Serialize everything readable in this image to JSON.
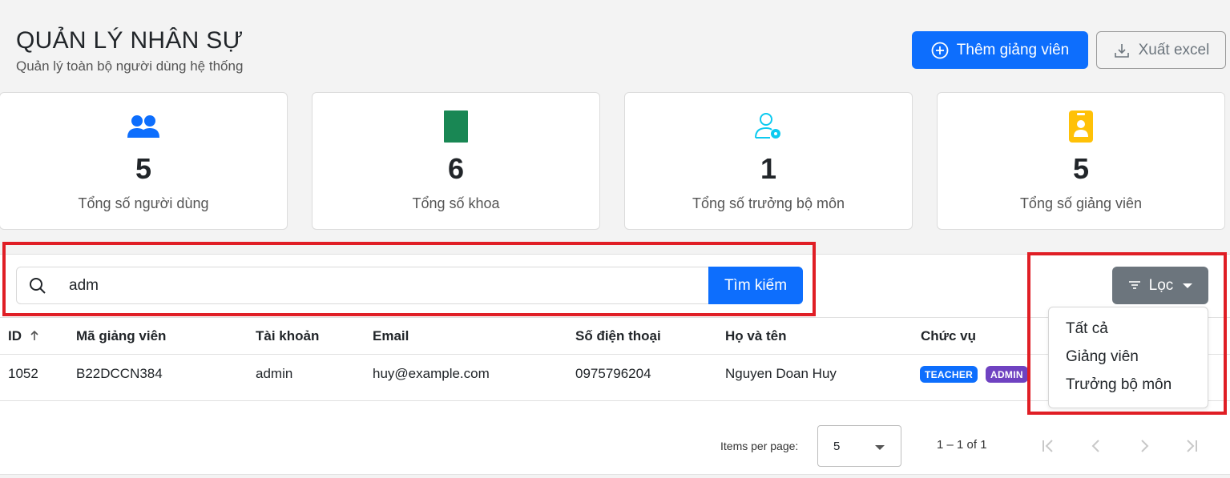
{
  "header": {
    "title": "QUẢN LÝ NHÂN SỰ",
    "subtitle": "Quản lý toàn bộ người dùng hệ thống",
    "add_button": "Thêm giảng viên",
    "export_button": "Xuất excel"
  },
  "stats": [
    {
      "value": "5",
      "label": "Tổng số người dùng",
      "icon": "users-icon",
      "color": "#0d6efd"
    },
    {
      "value": "6",
      "label": "Tổng số khoa",
      "icon": "book-icon",
      "color": "#198754"
    },
    {
      "value": "1",
      "label": "Tổng số trưởng bộ môn",
      "icon": "user-gear-icon",
      "color": "#0dcaf0"
    },
    {
      "value": "5",
      "label": "Tổng số giảng viên",
      "icon": "id-badge-icon",
      "color": "#ffc107"
    }
  ],
  "search": {
    "value": "adm",
    "button": "Tìm kiếm"
  },
  "filter": {
    "button": "Lọc",
    "options": [
      "Tất cả",
      "Giảng viên",
      "Trưởng bộ môn"
    ]
  },
  "table": {
    "columns": [
      "ID",
      "Mã giảng viên",
      "Tài khoản",
      "Email",
      "Số điện thoại",
      "Họ và tên",
      "Chức vụ"
    ],
    "rows": [
      {
        "id": "1052",
        "code": "B22DCCN384",
        "account": "admin",
        "email": "huy@example.com",
        "phone": "0975796204",
        "name": "Nguyen Doan Huy",
        "roles": [
          "TEACHER",
          "ADMIN"
        ]
      }
    ]
  },
  "pagination": {
    "items_per_page_label": "Items per page:",
    "items_per_page": "5",
    "range": "1 – 1 of 1"
  },
  "colors": {
    "primary": "#0d6efd",
    "secondary": "#6c757d",
    "admin_badge": "#6f42c1",
    "highlight": "#e01e25"
  }
}
